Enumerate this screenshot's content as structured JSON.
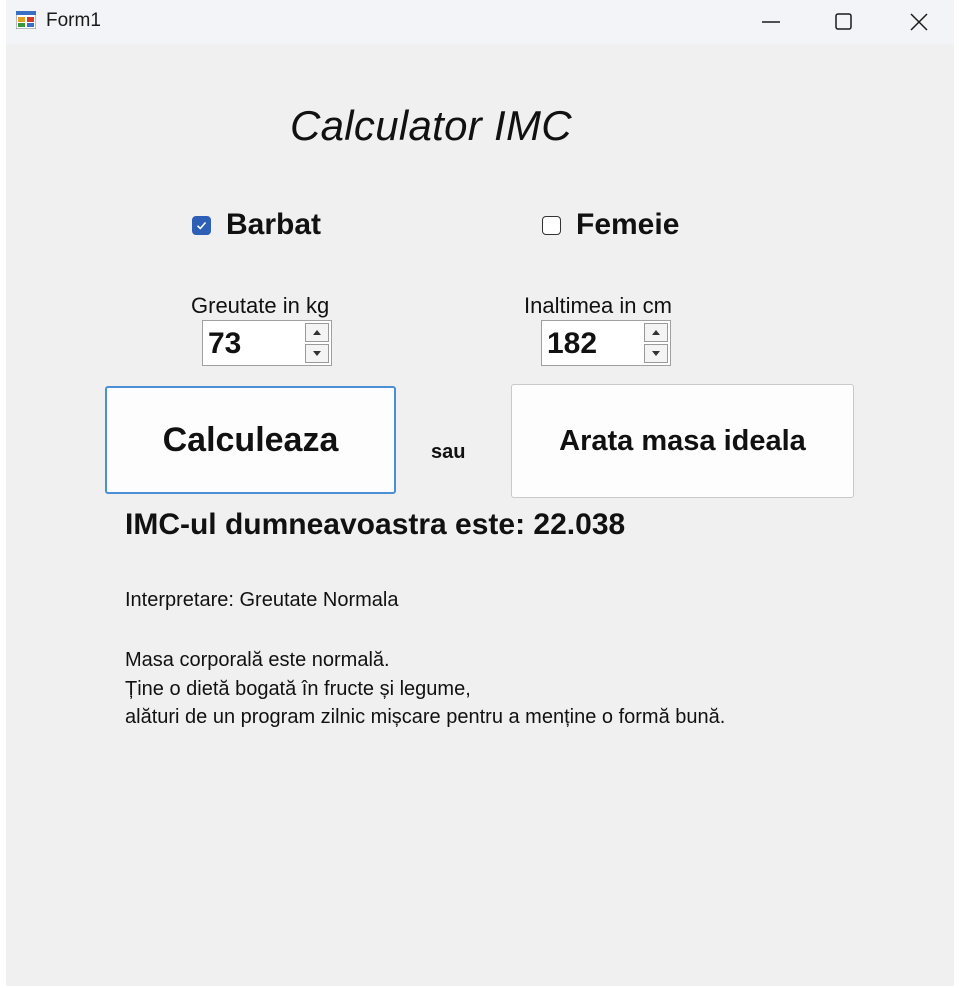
{
  "window": {
    "title": "Form1",
    "icon": "winforms-app-icon",
    "controls": [
      "minimize-icon",
      "maximize-icon",
      "close-icon"
    ]
  },
  "form": {
    "heading": "Calculator IMC",
    "gender": {
      "male_label": "Barbat",
      "male_checked": true,
      "female_label": "Femeie",
      "female_checked": false
    },
    "weight": {
      "label": "Greutate in kg",
      "value": "73"
    },
    "height": {
      "label": "Inaltimea in cm",
      "value": "182"
    },
    "calculate_label": "Calculeaza",
    "or_label": "sau",
    "ideal_label": "Arata masa ideala",
    "result_text": "IMC-ul dumneavoastra este: 22.038",
    "interpretation_text": "Interpretare:  Greutate Normala",
    "advice_lines": [
      "Masa corporală este normală.",
      "Ține o dietă bogată în fructe și legume,",
      "alături de un program zilnic mișcare pentru a menține o formă bună."
    ]
  },
  "colors": {
    "window_bg": "#f0f0f0",
    "accent": "#2d5fb6",
    "focus_border": "#4d8fd6"
  }
}
